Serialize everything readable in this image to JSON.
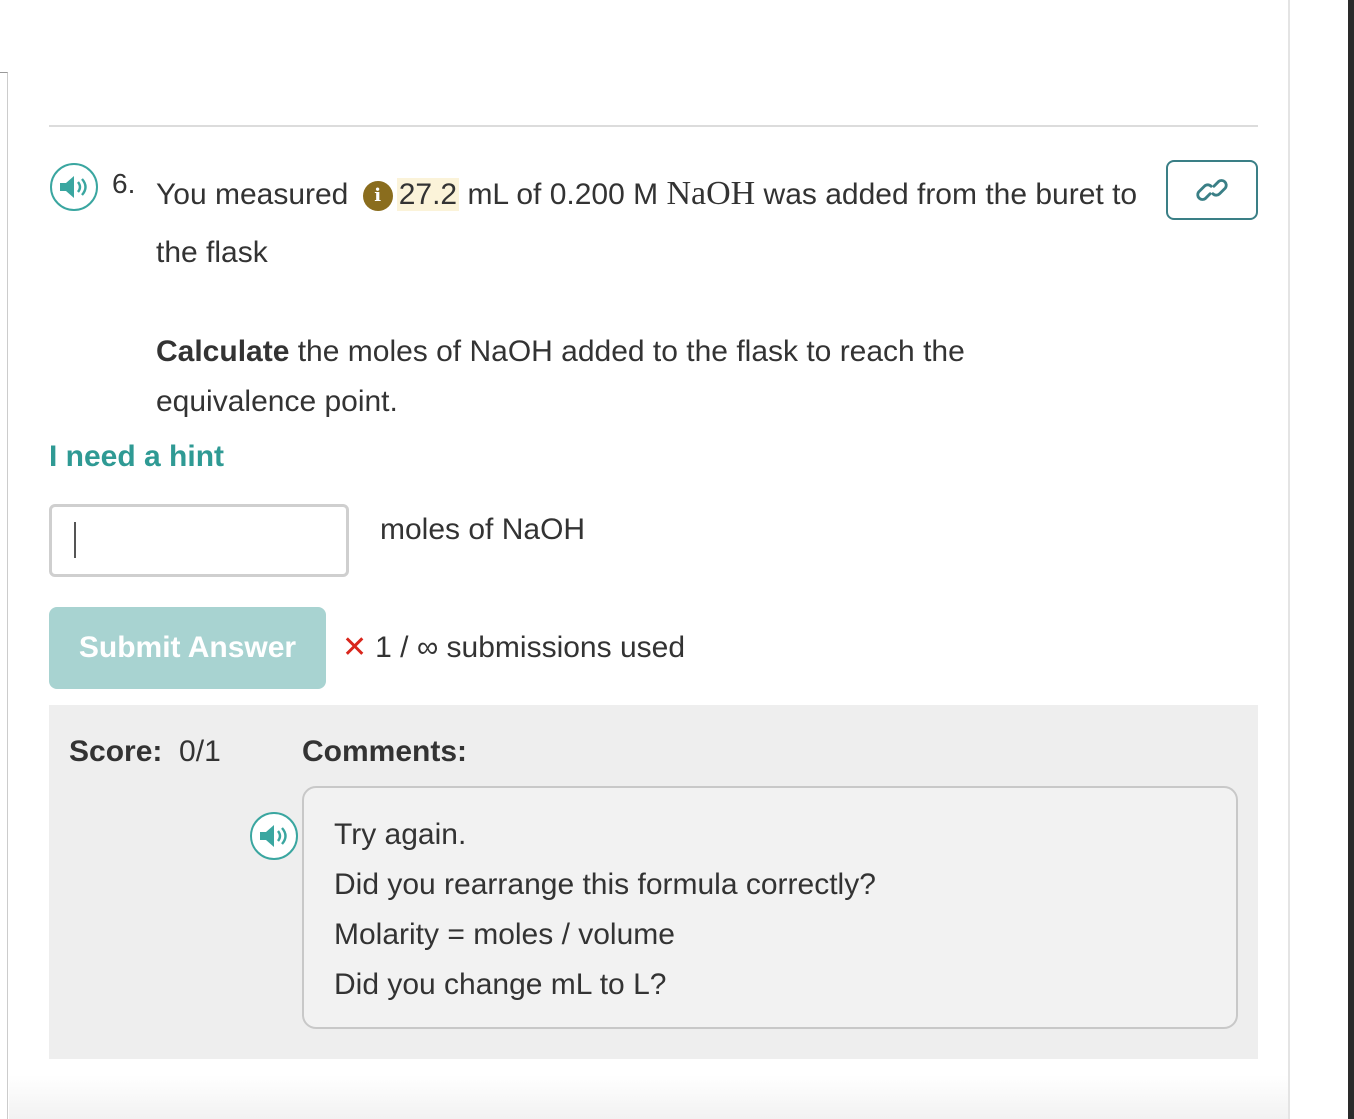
{
  "question": {
    "number": "6.",
    "text_before": "You measured",
    "info_badge": "i",
    "measured_value": "27.2",
    "text_after": " mL of 0.200 M ",
    "formula": "NaOH",
    "text_end": " was added from the buret to the flask",
    "prompt_bold": "Calculate",
    "prompt_rest": " the moles of NaOH added to the flask to reach the equivalence point."
  },
  "hint_label": "I need a hint",
  "answer": {
    "value": "",
    "unit": "moles of NaOH"
  },
  "submit_label": "Submit Answer",
  "submissions": {
    "mark": "✕",
    "text": "1 / ∞ submissions used"
  },
  "score": {
    "label": "Score:",
    "value": "0/1"
  },
  "comments": {
    "label": "Comments:",
    "lines": [
      "Try again.",
      "Did you rearrange this formula correctly?",
      "Molarity = moles / volume",
      "Did you change mL to L?"
    ]
  },
  "icons": {
    "speaker": "speaker-icon",
    "link": "link-icon",
    "info": "info-icon"
  },
  "colors": {
    "accent": "#3aa6a0",
    "hint": "#2f9a94",
    "submit_disabled": "#a8d3d1",
    "error": "#d9261c",
    "info_badge": "#8a6d1e",
    "highlight": "#fbf3d9",
    "feedback_bg": "#eeeeee"
  }
}
